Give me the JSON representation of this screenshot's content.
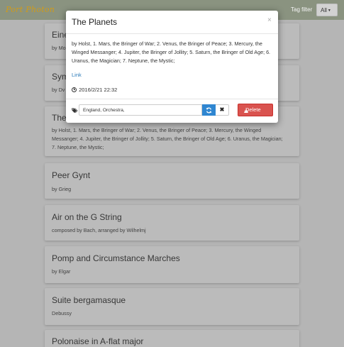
{
  "navbar": {
    "brand": "Port Photon",
    "tag_filter_label": "Tag filter",
    "filter_value": "All"
  },
  "cards": [
    {
      "title": "Eine",
      "subtitle": "by Mo"
    },
    {
      "title": "Sym",
      "subtitle": "by Dv"
    },
    {
      "title": "The",
      "subtitle": "by Holst, 1. Mars, the Bringer of War; 2. Venus, the Bringer of Peace; 3. Mercury, the Winged Messanger; 4. Jupiter, the Bringer of Jollity; 5. Saturn, the Bringer of Old Age; 6. Uranus, the Magician; 7. Neptune, the Mystic;"
    },
    {
      "title": "Peer Gynt",
      "subtitle": "by Grieg"
    },
    {
      "title": "Air on the G String",
      "subtitle": "composed by Bach, arranged by Wilhelmj"
    },
    {
      "title": "Pomp and Circumstance Marches",
      "subtitle": "by Elgar"
    },
    {
      "title": "Suite bergamasque",
      "subtitle": "Debussy"
    },
    {
      "title": "Polonaise in A-flat major",
      "subtitle": ""
    }
  ],
  "modal": {
    "title": "The Planets",
    "close": "×",
    "description": "by Holst, 1. Mars, the Bringer of War; 2. Venus, the Bringer of Peace; 3. Mercury, the Winged Messanger; 4. Jupiter, the Bringer of Jollity; 5. Saturn, the Bringer of Old Age; 6. Uranus, the Magician; 7. Neptune, the Mystic;",
    "link_label": "Link",
    "date": "2016/2/21 22:32",
    "tags_value": "England, Orchestra,",
    "clear_label": "✖",
    "delete_label": "Delete"
  },
  "icons": {
    "clock": "clock-icon",
    "tags": "tags-icon",
    "refresh": "refresh-icon",
    "clear": "close-icon",
    "warning": "warning-icon",
    "caret": "caret-down-icon"
  },
  "colors": {
    "navbar": "#909a86",
    "brand": "#d9a21b",
    "primary": "#2f86d1",
    "danger": "#d9534f",
    "link": "#2a7ab8"
  }
}
